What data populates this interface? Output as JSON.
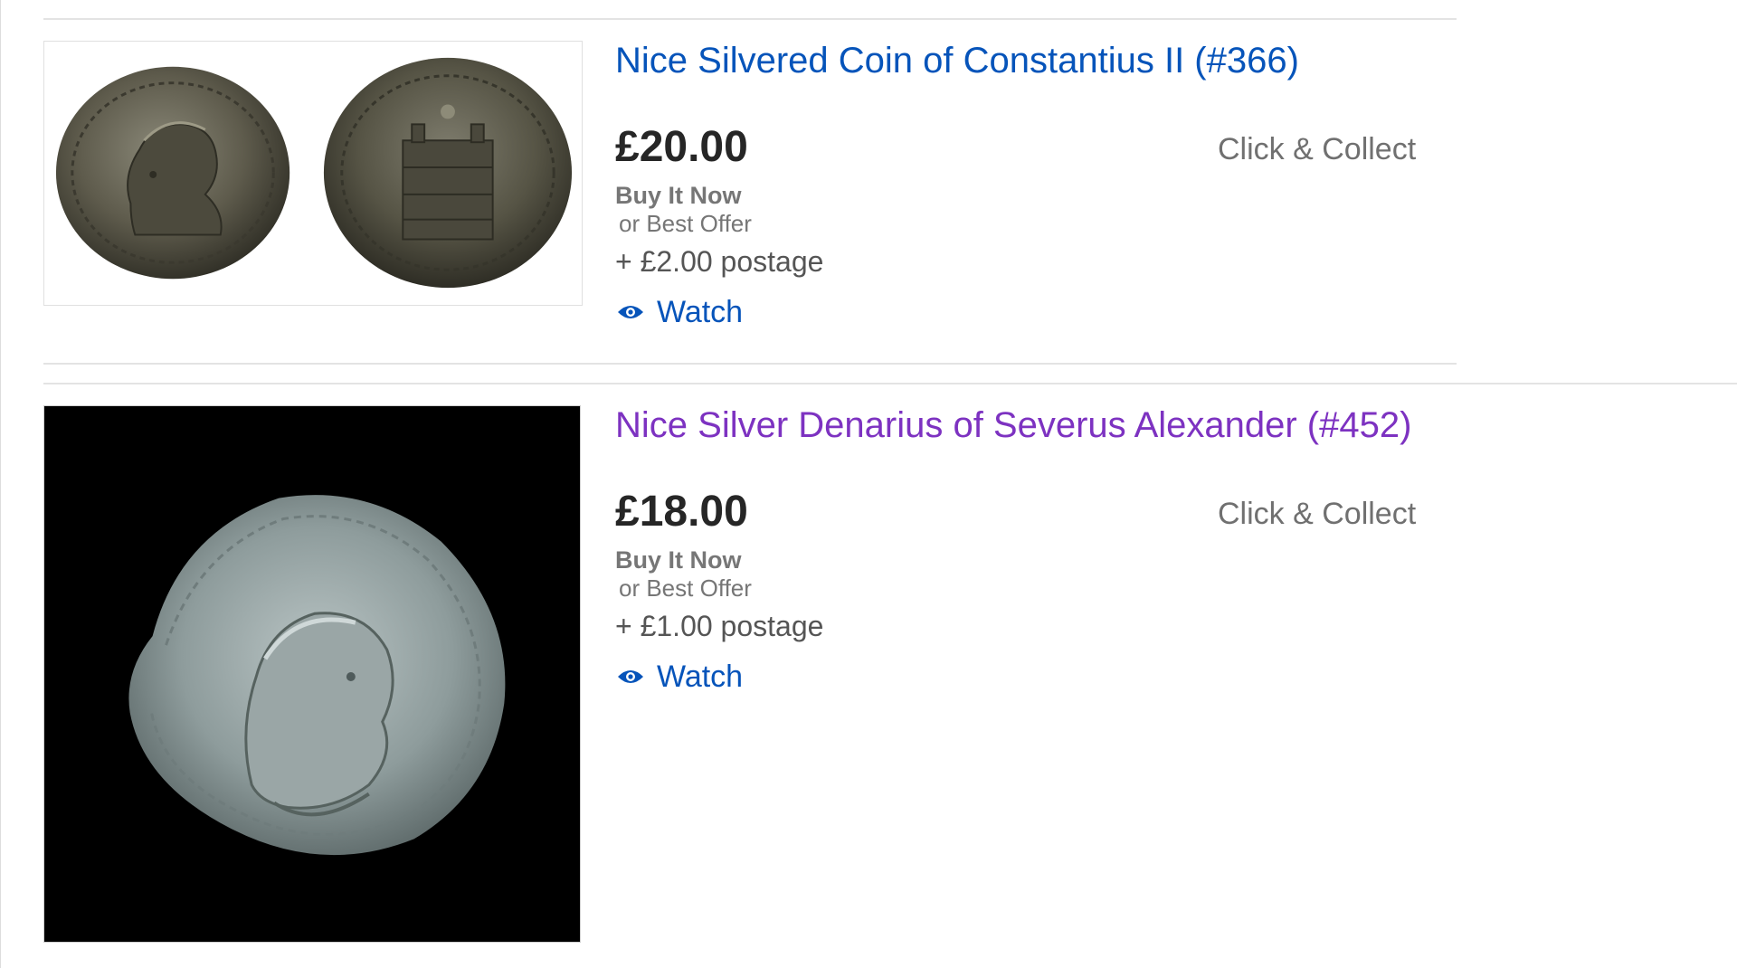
{
  "listings": [
    {
      "title": "Nice Silvered Coin of Constantius II (#366)",
      "title_state": "unvisited",
      "image_alt": "two-sided-bronze-coin-image",
      "price": "£20.00",
      "format": "Buy It Now",
      "best_offer": "or Best Offer",
      "postage": "+ £2.00 postage",
      "collect": "Click & Collect",
      "watch_label": "Watch"
    },
    {
      "title": "Nice Silver Denarius of Severus Alexander (#452)",
      "title_state": "visited",
      "image_alt": "silver-denarius-image",
      "price": "£18.00",
      "format": "Buy It Now",
      "best_offer": "or Best Offer",
      "postage": "+ £1.00 postage",
      "collect": "Click & Collect",
      "watch_label": "Watch"
    }
  ],
  "colors": {
    "link_unvisited": "#0654ba",
    "link_visited": "#7d32c1",
    "price_text": "#262626",
    "muted_text": "#767676",
    "divider": "#e3e3e3"
  },
  "icons": {
    "watch": "eye-icon"
  }
}
